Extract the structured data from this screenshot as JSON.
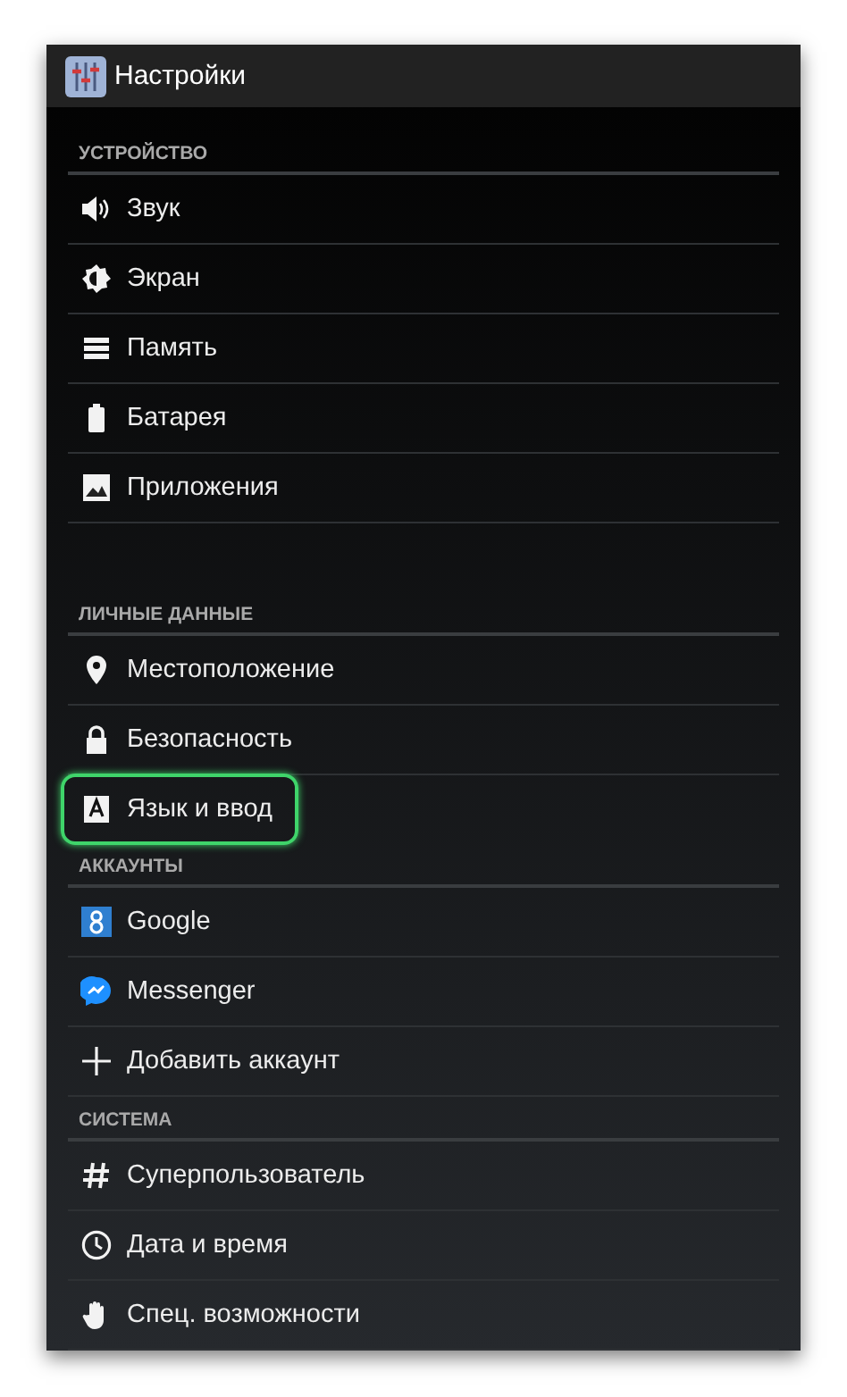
{
  "window": {
    "title": "Настройки"
  },
  "sections": [
    {
      "title": "УСТРОЙСТВО",
      "items": [
        {
          "label": "Звук",
          "highlighted": false
        },
        {
          "label": "Экран",
          "highlighted": false
        },
        {
          "label": "Память",
          "highlighted": false
        },
        {
          "label": "Батарея",
          "highlighted": false
        },
        {
          "label": "Приложения",
          "highlighted": false
        }
      ]
    },
    {
      "title": "ЛИЧНЫЕ ДАННЫЕ",
      "items": [
        {
          "label": "Местоположение",
          "highlighted": false
        },
        {
          "label": "Безопасность",
          "highlighted": false
        },
        {
          "label": "Язык и ввод",
          "highlighted": true
        }
      ]
    },
    {
      "title": "АККАУНТЫ",
      "items": [
        {
          "label": "Google",
          "highlighted": false
        },
        {
          "label": "Messenger",
          "highlighted": false
        },
        {
          "label": "Добавить аккаунт",
          "highlighted": false
        }
      ]
    },
    {
      "title": "СИСТЕМА",
      "items": [
        {
          "label": "Суперпользователь",
          "highlighted": false
        },
        {
          "label": "Дата и время",
          "highlighted": false
        },
        {
          "label": "Спец. возможности",
          "highlighted": false
        }
      ]
    }
  ]
}
